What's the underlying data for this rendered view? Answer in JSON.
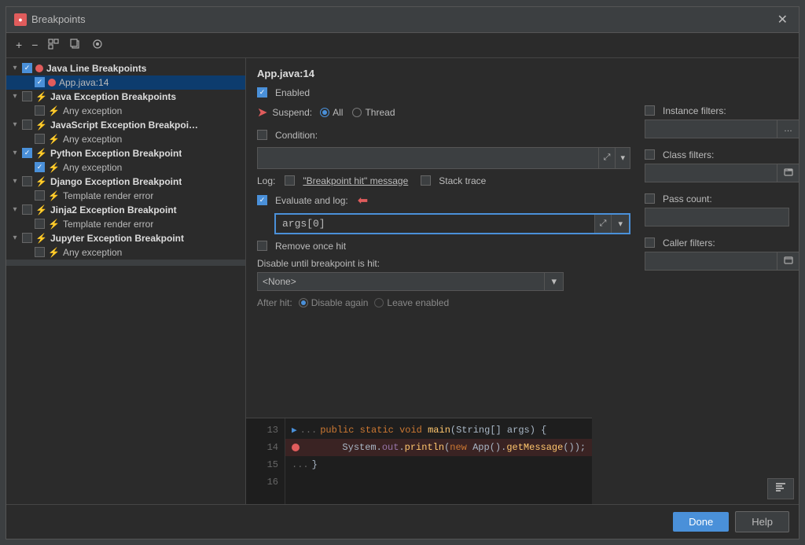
{
  "dialog": {
    "title": "Breakpoints",
    "icon": "●"
  },
  "toolbar": {
    "add": "+",
    "remove": "−",
    "group": "⊞",
    "copy": "⧉",
    "expand": "◉"
  },
  "tree": {
    "items": [
      {
        "id": "java-line",
        "level": 1,
        "label": "Java Line Breakpoints",
        "checked": true,
        "expanded": true,
        "hasLightning": false,
        "hasDot": false,
        "bold": true
      },
      {
        "id": "app-java",
        "level": 2,
        "label": "App.java:14",
        "checked": true,
        "expanded": false,
        "hasLightning": false,
        "hasDot": true,
        "bold": false,
        "selected": true
      },
      {
        "id": "java-exception",
        "level": 1,
        "label": "Java Exception Breakpoints",
        "checked": false,
        "expanded": true,
        "hasLightning": true,
        "hasDot": false,
        "bold": true
      },
      {
        "id": "java-any",
        "level": 2,
        "label": "Any exception",
        "checked": false,
        "expanded": false,
        "hasLightning": true,
        "hasDot": false,
        "bold": false
      },
      {
        "id": "js-exception",
        "level": 1,
        "label": "JavaScript Exception Breakpoints",
        "checked": false,
        "expanded": true,
        "hasLightning": true,
        "hasDot": false,
        "bold": true
      },
      {
        "id": "js-any",
        "level": 2,
        "label": "Any exception",
        "checked": false,
        "expanded": false,
        "hasLightning": true,
        "hasDot": false,
        "bold": false
      },
      {
        "id": "python-exception",
        "level": 1,
        "label": "Python Exception Breakpoint",
        "checked": true,
        "expanded": true,
        "hasLightning": true,
        "hasDot": false,
        "bold": true
      },
      {
        "id": "python-any",
        "level": 2,
        "label": "Any exception",
        "checked": true,
        "expanded": false,
        "hasLightning": true,
        "hasDot": false,
        "bold": false
      },
      {
        "id": "django-exception",
        "level": 1,
        "label": "Django Exception Breakpoint",
        "checked": false,
        "expanded": true,
        "hasLightning": true,
        "hasDot": false,
        "bold": true
      },
      {
        "id": "django-template",
        "level": 2,
        "label": "Template render error",
        "checked": false,
        "expanded": false,
        "hasLightning": true,
        "hasDot": false,
        "bold": false
      },
      {
        "id": "jinja2-exception",
        "level": 1,
        "label": "Jinja2 Exception Breakpoint",
        "checked": false,
        "expanded": true,
        "hasLightning": true,
        "hasDot": false,
        "bold": true
      },
      {
        "id": "jinja2-template",
        "level": 2,
        "label": "Template render error",
        "checked": false,
        "expanded": false,
        "hasLightning": true,
        "hasDot": false,
        "bold": false
      },
      {
        "id": "jupyter-exception",
        "level": 1,
        "label": "Jupyter Exception Breakpoint",
        "checked": false,
        "expanded": true,
        "hasLightning": true,
        "hasDot": false,
        "bold": true
      },
      {
        "id": "jupyter-any",
        "level": 2,
        "label": "Any exception",
        "checked": false,
        "expanded": false,
        "hasLightning": true,
        "hasDot": false,
        "bold": false
      }
    ]
  },
  "right": {
    "title": "App.java:14",
    "enabled_label": "Enabled",
    "suspend_label": "Suspend:",
    "all_label": "All",
    "thread_label": "Thread",
    "condition_label": "Condition:",
    "log_label": "Log:",
    "breakpoint_hit_label": "\"Breakpoint hit\" message",
    "stack_trace_label": "Stack trace",
    "evaluate_label": "Evaluate and log:",
    "evaluate_value": "args[0]",
    "remove_once_hit_label": "Remove once hit",
    "disable_until_label": "Disable until breakpoint is hit:",
    "none_option": "<None>",
    "after_hit_label": "After hit:",
    "disable_again_label": "Disable again",
    "leave_enabled_label": "Leave enabled"
  },
  "filters": {
    "instance_label": "Instance filters:",
    "class_label": "Class filters:",
    "pass_count_label": "Pass count:",
    "caller_label": "Caller filters:"
  },
  "code": {
    "lines": [
      {
        "num": "13",
        "text": "    public static void main(String[] args) {",
        "active": false,
        "has_bp": false,
        "has_arrow": true
      },
      {
        "num": "14",
        "text": "        System.out.println(new App().getMessage());",
        "active": true,
        "has_bp": true,
        "has_arrow": false
      },
      {
        "num": "15",
        "text": "    }",
        "active": false,
        "has_bp": false,
        "has_arrow": false
      },
      {
        "num": "16",
        "text": "",
        "active": false,
        "has_bp": false,
        "has_arrow": false
      }
    ]
  },
  "buttons": {
    "done": "Done",
    "help": "Help"
  }
}
